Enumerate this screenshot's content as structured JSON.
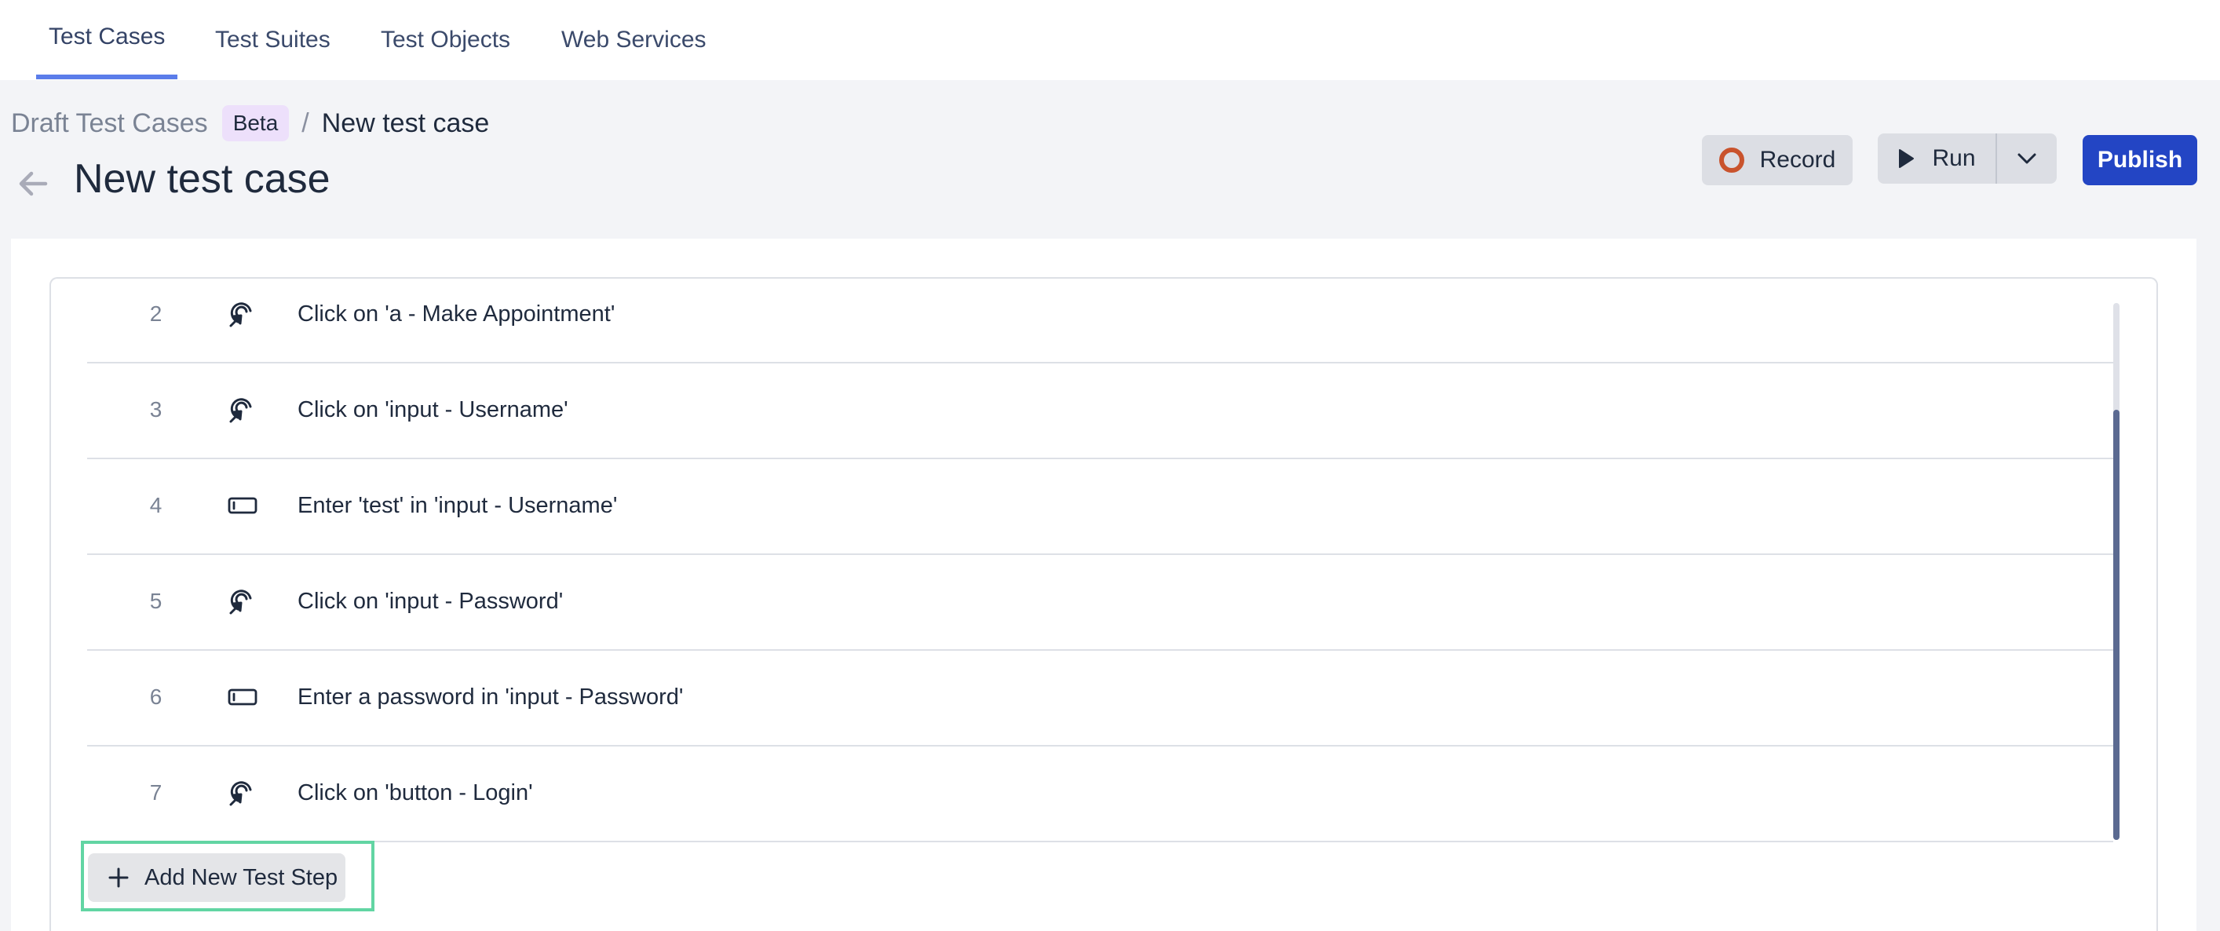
{
  "nav": {
    "tabs": [
      {
        "label": "Test Cases",
        "active": true
      },
      {
        "label": "Test Suites",
        "active": false
      },
      {
        "label": "Test Objects",
        "active": false
      },
      {
        "label": "Web Services",
        "active": false
      }
    ]
  },
  "breadcrumb": {
    "root": "Draft Test Cases",
    "badge": "Beta",
    "separator": "/",
    "current": "New test case"
  },
  "header": {
    "back_icon": "arrow-left-icon",
    "title": "New test case"
  },
  "toolbar": {
    "record_label": "Record",
    "record_icon": "record-icon",
    "run_label": "Run",
    "run_icon": "play-icon",
    "run_menu_icon": "chevron-down-icon",
    "publish_label": "Publish",
    "accent_color": "#2345c4",
    "record_color": "#c9532d"
  },
  "steps": [
    {
      "number": "2",
      "icon": "click-icon",
      "text": "Click on 'a - Make Appointment'"
    },
    {
      "number": "3",
      "icon": "click-icon",
      "text": "Click on 'input - Username'"
    },
    {
      "number": "4",
      "icon": "input-field-icon",
      "text": "Enter 'test' in 'input - Username'"
    },
    {
      "number": "5",
      "icon": "click-icon",
      "text": "Click on 'input - Password'"
    },
    {
      "number": "6",
      "icon": "input-field-icon",
      "text": "Enter a password in 'input - Password'"
    },
    {
      "number": "7",
      "icon": "click-icon",
      "text": "Click on 'button - Login'"
    }
  ],
  "add_step": {
    "label": "Add New Test Step",
    "icon": "plus-icon",
    "highlight_color": "#62d5a3"
  }
}
